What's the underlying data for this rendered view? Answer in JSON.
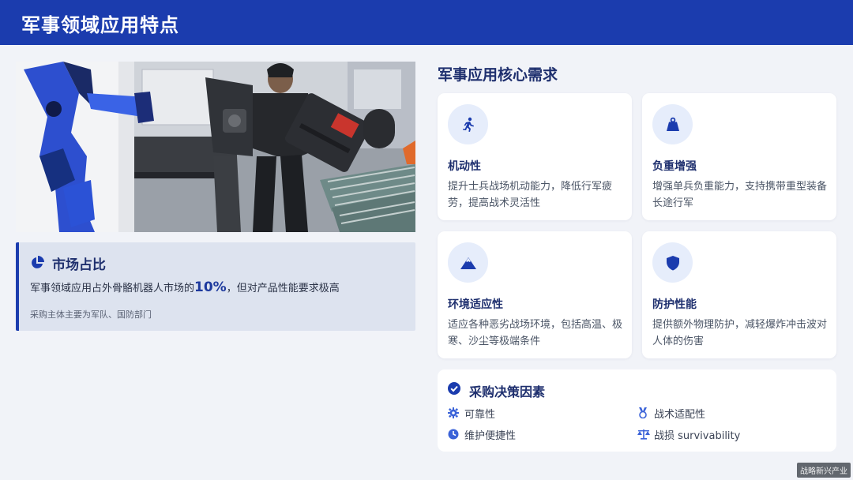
{
  "header": {
    "title": "军事领域应用特点"
  },
  "photo": {
    "alt": "exoskeleton-photo"
  },
  "market": {
    "heading": "市场占比",
    "desc_prefix": "军事领域应用占外骨骼机器人市场的",
    "share": "10%",
    "desc_suffix": "，但对产品性能要求极高",
    "note": "采购主体主要为军队、国防部门"
  },
  "requirements": {
    "title": "军事应用核心需求",
    "cards": [
      {
        "title": "机动性",
        "desc": "提升士兵战场机动能力，降低行军疲劳，提高战术灵活性",
        "icon": "running-icon"
      },
      {
        "title": "负重增强",
        "desc": "增强单兵负重能力，支持携带重型装备长途行军",
        "icon": "weight-icon"
      },
      {
        "title": "环境适应性",
        "desc": "适应各种恶劣战场环境，包括高温、极寒、沙尘等极端条件",
        "icon": "mountain-icon"
      },
      {
        "title": "防护性能",
        "desc": "提供额外物理防护，减轻爆炸冲击波对人体的伤害",
        "icon": "shield-icon"
      }
    ]
  },
  "factors": {
    "heading": "采购决策因素",
    "items": [
      {
        "label": "可靠性",
        "icon": "gear-icon"
      },
      {
        "label": "战术适配性",
        "icon": "medal-icon"
      },
      {
        "label": "维护便捷性",
        "icon": "clock-icon"
      },
      {
        "label": "战损 survivability",
        "icon": "scale-icon"
      }
    ]
  },
  "watermark": "战略新兴产业",
  "colors": {
    "brand": "#1b3cae",
    "accent": "#1e3a9e",
    "card_bg": "#ffffff",
    "page_bg": "#f1f3f8"
  }
}
